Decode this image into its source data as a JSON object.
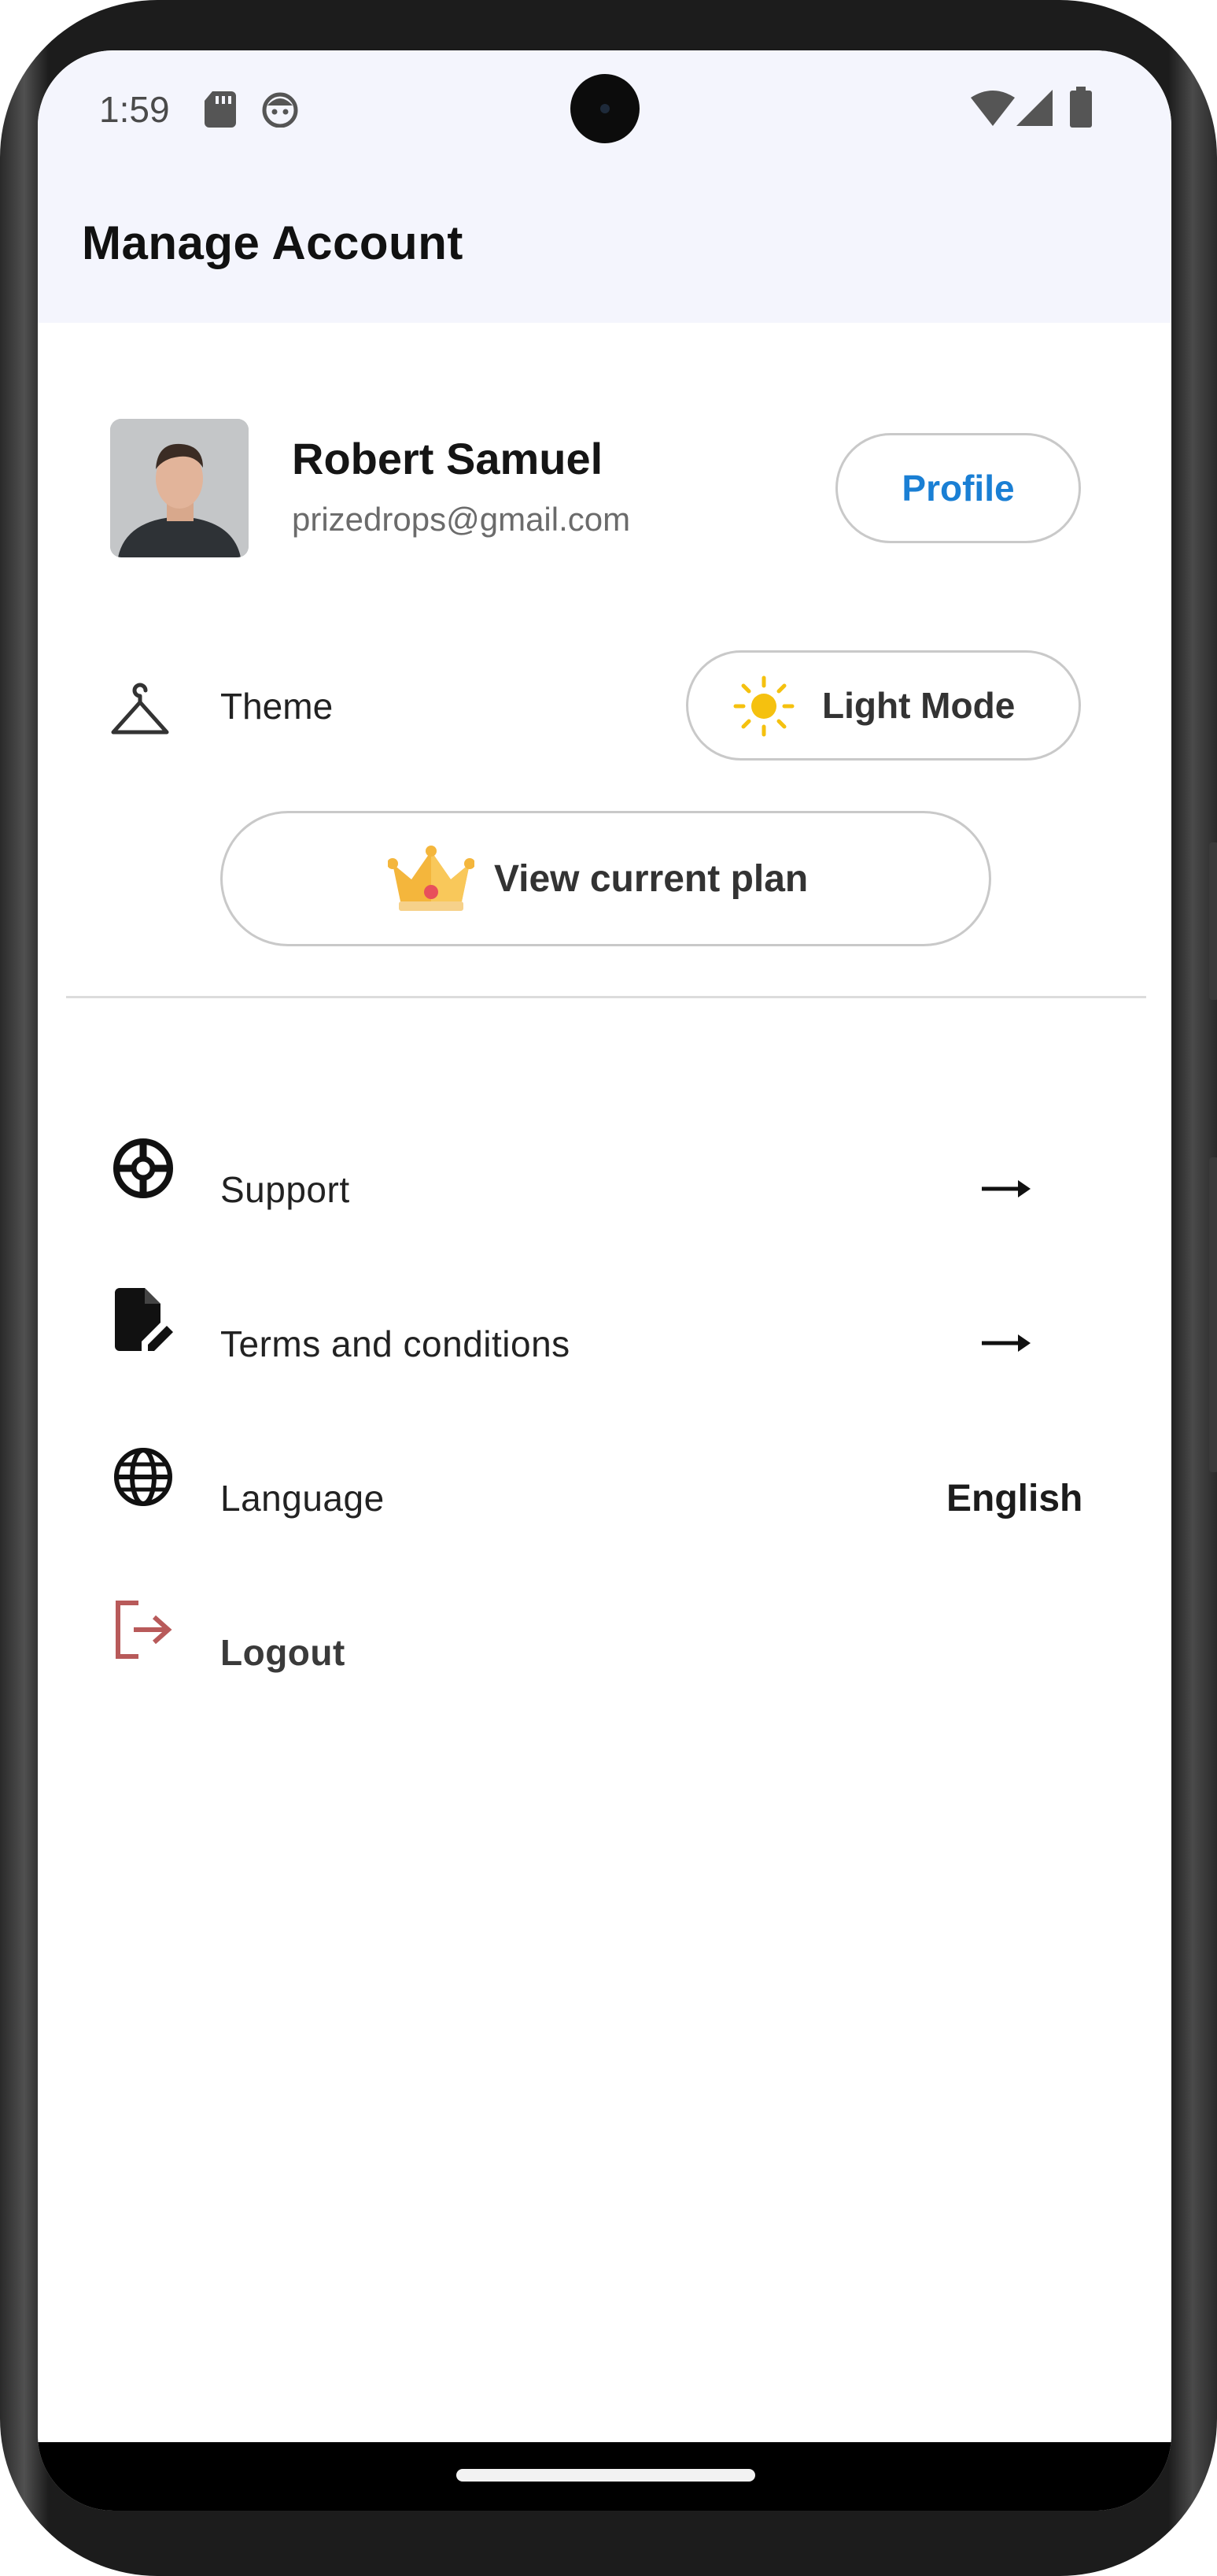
{
  "status_bar": {
    "time": "1:59",
    "icons": [
      "sd-card-icon",
      "notification-face-icon",
      "wifi-icon",
      "signal-icon",
      "battery-icon"
    ]
  },
  "header": {
    "title": "Manage Account",
    "background": "#f4f5fd"
  },
  "user": {
    "name": "Robert Samuel",
    "email": "prizedrops@gmail.com",
    "profile_button": "Profile"
  },
  "theme": {
    "label": "Theme",
    "mode_button": "Light Mode",
    "mode_icon": "sun-icon"
  },
  "plan": {
    "button": "View current plan",
    "icon": "crown-icon"
  },
  "menu": {
    "support": "Support",
    "terms": "Terms and conditions",
    "language": "Language",
    "language_value": "English",
    "logout": "Logout"
  },
  "colors": {
    "accent": "#1a7fd4",
    "logout_icon": "#b85a5a",
    "sun": "#f5c10f",
    "crown": "#f4b63c"
  }
}
